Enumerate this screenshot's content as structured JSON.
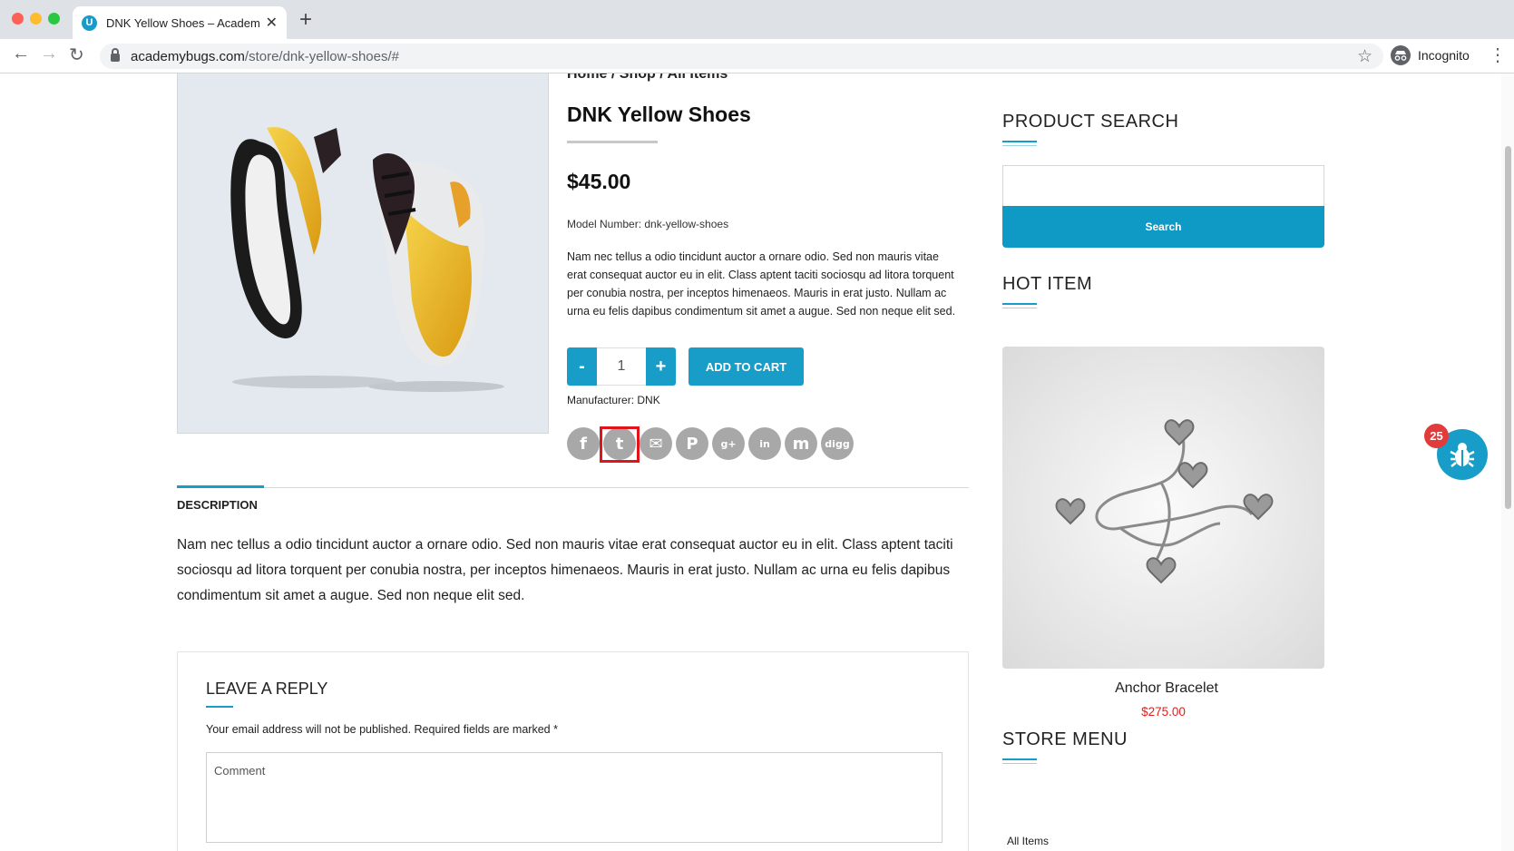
{
  "browser": {
    "tab_title": "DNK Yellow Shoes – AcademyBugs",
    "tab_favicon_letter": "U",
    "url_host": "academybugs.com",
    "url_path": "/store/dnk-yellow-shoes/#",
    "profile_label": "Incognito"
  },
  "product": {
    "breadcrumb": "Home / Shop / All Items",
    "title": "DNK Yellow Shoes",
    "price": "$45.00",
    "model_number": "Model Number: dnk-yellow-shoes",
    "short_description": "Nam nec tellus a odio tincidunt auctor a ornare odio. Sed non mauris vitae erat consequat auctor eu in elit. Class aptent taciti sociosqu ad litora torquent per conubia nostra, per inceptos himenaeos. Mauris in erat justo. Nullam ac urna eu felis dapibus condimentum sit amet a augue. Sed non neque elit sed.",
    "quantity": "1",
    "minus_label": "-",
    "plus_label": "+",
    "add_to_cart_label": "ADD TO CART",
    "manufacturer": "Manufacturer: DNK"
  },
  "share": {
    "icons": [
      "facebook-icon",
      "twitter-icon",
      "email-icon",
      "pinterest-icon",
      "google-plus-icon",
      "linkedin-icon",
      "myspace-icon",
      "digg-icon"
    ],
    "facebook_glyph": "f",
    "twitter_glyph": "t",
    "email_glyph": "✉",
    "pinterest_glyph": "P",
    "google_glyph": "g+",
    "linkedin_glyph": "in",
    "myspace_glyph": "m",
    "digg_glyph": "digg",
    "highlight_color": "#e0151b"
  },
  "description": {
    "tab_label": "DESCRIPTION",
    "text": "Nam nec tellus a odio tincidunt auctor a ornare odio. Sed non mauris vitae erat consequat auctor eu in elit. Class aptent taciti sociosqu ad litora torquent per conubia nostra, per inceptos himenaeos. Mauris in erat justo. Nullam ac urna eu felis dapibus condimentum sit amet a augue. Sed non neque elit sed."
  },
  "reply": {
    "title": "LEAVE A REPLY",
    "note": "Your email address will not be published. Required fields are marked *",
    "comment_placeholder": "Comment"
  },
  "sidebar": {
    "product_search_title": "PRODUCT SEARCH",
    "search_button_label": "Search",
    "hot_item_title": "HOT ITEM",
    "hot_item_name": "Anchor Bracelet",
    "hot_item_price": "$275.00",
    "store_menu_title": "STORE MENU",
    "store_menu_items": [
      "All Items"
    ]
  },
  "bug_widget": {
    "count": "25"
  },
  "colors": {
    "accent": "#189dc9",
    "price_red": "#e02020"
  }
}
